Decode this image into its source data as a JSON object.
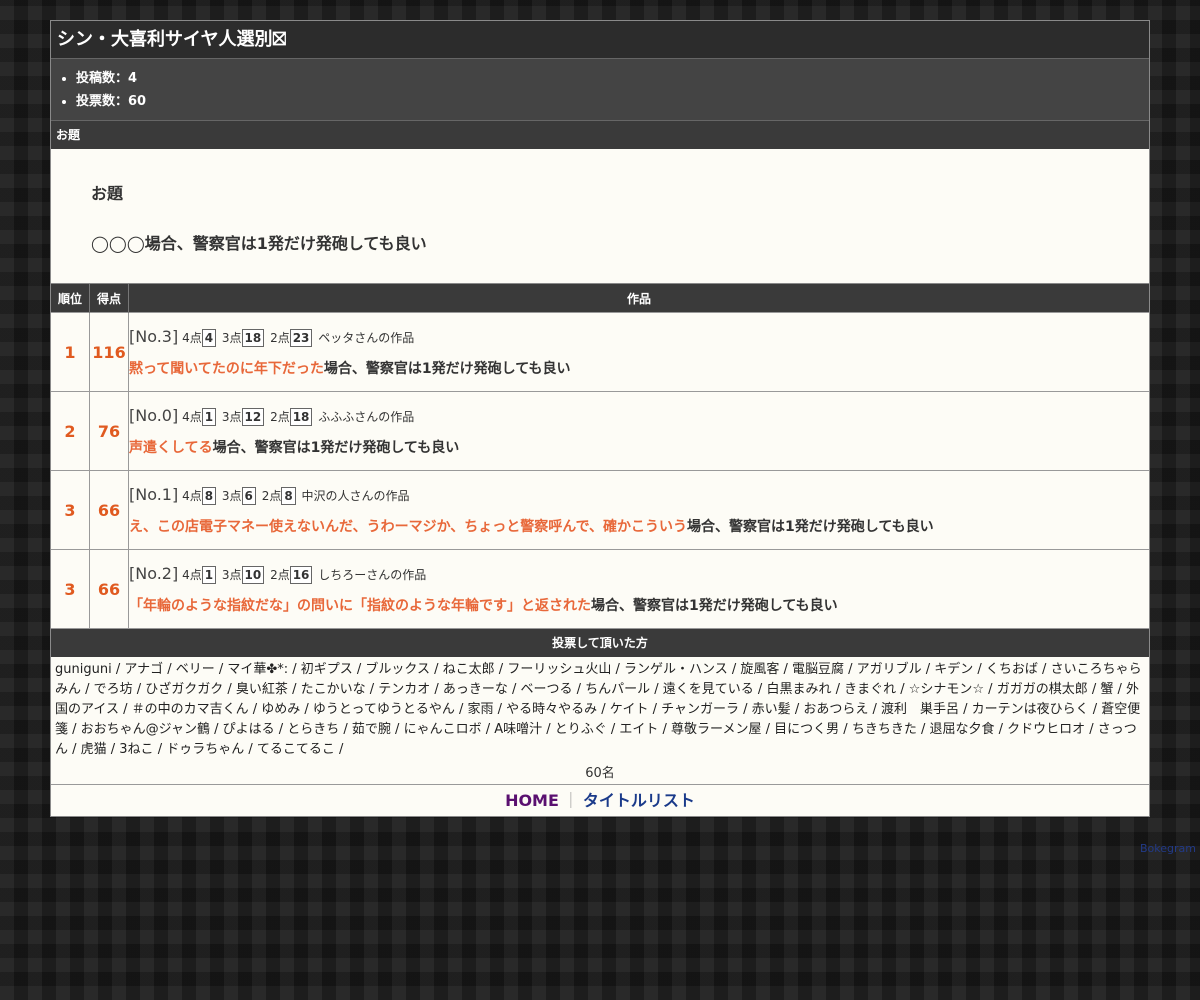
{
  "title": "シン・大喜利サイヤ人選別⛝",
  "stats": {
    "posts": "投稿数：4",
    "votes": "投票数：60"
  },
  "odai_section": {
    "header": "お題",
    "label": "お題",
    "text": "◯◯◯場合、警察官は1発だけ発砲しても良い"
  },
  "results_table": {
    "col_rank": "順位",
    "col_score": "得点",
    "col_work": "作品",
    "rows": [
      {
        "rank": "1",
        "score": "116",
        "no": "[No.3]",
        "p4_label": "4点",
        "p4": "4",
        "p3_label": "3点",
        "p3": "18",
        "p2_label": "2点",
        "p2": "23",
        "author": "ペッタさんの作品",
        "answer": "黙って聞いてたのに年下だった",
        "suffix": "場合、警察官は1発だけ発砲しても良い"
      },
      {
        "rank": "2",
        "score": "76",
        "no": "[No.0]",
        "p4_label": "4点",
        "p4": "1",
        "p3_label": "3点",
        "p3": "12",
        "p2_label": "2点",
        "p2": "18",
        "author": "ふふふさんの作品",
        "answer": "声遣くしてる",
        "suffix": "場合、警察官は1発だけ発砲しても良い"
      },
      {
        "rank": "3",
        "score": "66",
        "no": "[No.1]",
        "p4_label": "4点",
        "p4": "8",
        "p3_label": "3点",
        "p3": "6",
        "p2_label": "2点",
        "p2": "8",
        "author": "中沢の人さんの作品",
        "answer": "え、この店電子マネー使えないんだ、うわーマジか、ちょっと警察呼んで、確かこういう",
        "suffix": "場合、警察官は1発だけ発砲しても良い"
      },
      {
        "rank": "3",
        "score": "66",
        "no": "[No.2]",
        "p4_label": "4点",
        "p4": "1",
        "p3_label": "3点",
        "p3": "10",
        "p2_label": "2点",
        "p2": "16",
        "author": "しちろーさんの作品",
        "answer": "「年輪のような指紋だな」の問いに「指紋のような年輪です」と返された",
        "suffix": "場合、警察官は1発だけ発砲しても良い"
      }
    ]
  },
  "voters": {
    "header": "投票して頂いた方",
    "list": "guniguni / アナゴ / ベリー / マイ華✤*: / 初ギプス / ブルックス / ねこ太郎 / フーリッシュ火山 / ランゲル・ハンス / 旋風客 / 電脳豆腐 / アガリブル / キデン / くちおば / さいころちゃらみん / でろ坊 / ひざガクガク / 臭い紅茶 / たこかいな / テンカオ / あっきーな / ベーつる / ちんパール / 遠くを見ている / 白黒まみれ / きまぐれ / ☆シナモン☆ / ガガガの棋太郎 / 蟹 / 外国のアイス / ＃の中のカマ吉くん / ゆめみ / ゆうとってゆうとるやん / 家雨 / やる時々やるみ / ケイト / チャンガーラ / 赤い髪 / おあつらえ / 渡利　巣手呂 / カーテンは夜ひらく / 蒼空便箋 / おおちゃん@ジャン鶴 / ぴよはる / とらきち / 茹で腕 / にゃんこロボ / A味噌汁 / とりふぐ / エイト / 尊敬ラーメン屋 / 目につく男 / ちきちきた / 退屈な夕食 / クドウヒロオ / さっつん / 虎猫 / 3ねこ / ドゥラちゃん / てるこてるこ /",
    "count": "60名"
  },
  "footer": {
    "home": "HOME",
    "separator": "｜",
    "title_list": "タイトルリスト"
  },
  "credit": "Bokegram",
  "colors": {
    "accent_orange": "#e05a20",
    "highlight_orange": "#e8683a",
    "header_dark": "#3a3a3a",
    "home_purple": "#5a1070",
    "link_blue": "#1a3a8a"
  }
}
